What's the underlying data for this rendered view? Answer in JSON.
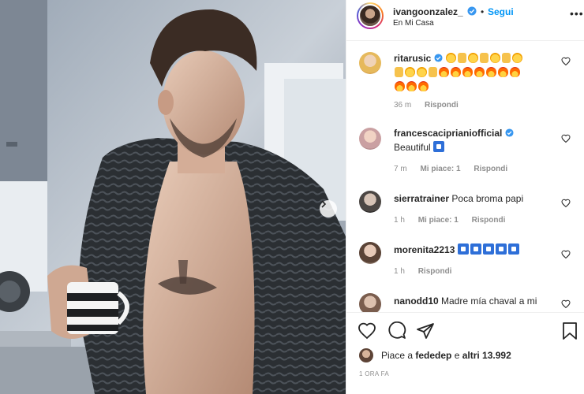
{
  "header": {
    "username": "ivangoonzalez_",
    "separator": "•",
    "follow_label": "Segui",
    "location": "En Mi Casa",
    "more_label": "•••"
  },
  "comments": [
    {
      "username": "ritarusic",
      "verified": true,
      "text": "",
      "emoji_sequence": [
        "star-eyes",
        "thumbs-up",
        "star-eyes",
        "thumbs-up",
        "star-eyes",
        "thumbs-up",
        "star-eyes",
        "thumbs-up",
        "star-eyes",
        "star-eyes",
        "thumbs-up",
        "fire",
        "fire",
        "fire",
        "fire",
        "fire",
        "fire",
        "fire",
        "fire",
        "fire",
        "fire"
      ],
      "time": "36 m",
      "likes": "",
      "reply_label": "Rispondi"
    },
    {
      "username": "francescaciprianiofficial",
      "verified": true,
      "text": "Beautiful",
      "emoji_sequence": [
        "blue-top"
      ],
      "time": "7 m",
      "likes": "Mi piace: 1",
      "reply_label": "Rispondi"
    },
    {
      "username": "sierratrainer",
      "verified": false,
      "text": "Poca broma papi",
      "emoji_sequence": [],
      "time": "1 h",
      "likes": "Mi piace: 1",
      "reply_label": "Rispondi"
    },
    {
      "username": "morenita2213",
      "verified": false,
      "text": "",
      "emoji_sequence": [
        "blue-top",
        "blue-top",
        "blue-top",
        "blue-top",
        "blue-top"
      ],
      "time": "1 h",
      "likes": "",
      "reply_label": "Rispondi"
    },
    {
      "username": "nanodd10",
      "verified": false,
      "text": "Madre mía chaval a mi",
      "emoji_sequence": [],
      "time": "",
      "likes": "",
      "reply_label": ""
    }
  ],
  "actions": {
    "like_icon": "heart-icon",
    "comment_icon": "comment-bubble-icon",
    "share_icon": "paper-plane-icon",
    "save_icon": "bookmark-icon"
  },
  "likes": {
    "prefix": "Piace a ",
    "user": "fededep",
    "middle": " e ",
    "others": "altri 13.992"
  },
  "time_ago": "1 ORA FA",
  "colors": {
    "link_blue": "#0095f6",
    "verified_blue": "#3897f0",
    "meta_gray": "#8e8e8e",
    "text_dark": "#262626"
  }
}
